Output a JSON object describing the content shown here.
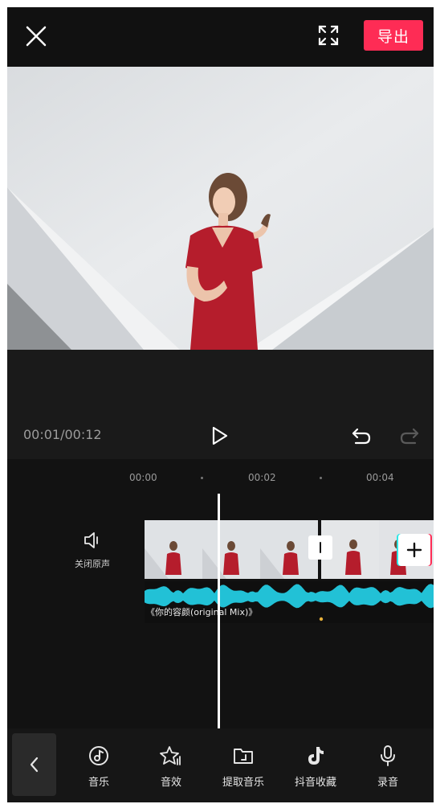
{
  "header": {
    "export_label": "导出"
  },
  "player": {
    "time_display": "00:01/00:12"
  },
  "timeline": {
    "ruler": [
      "00:00",
      "00:02",
      "00:04"
    ],
    "mute_label": "关闭原声",
    "audio_track_label": "《你的容颜(original Mix)》"
  },
  "toolbar": {
    "items": [
      {
        "label": "音乐",
        "icon": "music-icon"
      },
      {
        "label": "音效",
        "icon": "sound-effect-icon"
      },
      {
        "label": "提取音乐",
        "icon": "folder-icon"
      },
      {
        "label": "抖音收藏",
        "icon": "tiktok-icon"
      },
      {
        "label": "录音",
        "icon": "microphone-icon"
      }
    ]
  },
  "colors": {
    "accent": "#fe2c55",
    "waveform": "#22c1d6",
    "background": "#111111"
  }
}
